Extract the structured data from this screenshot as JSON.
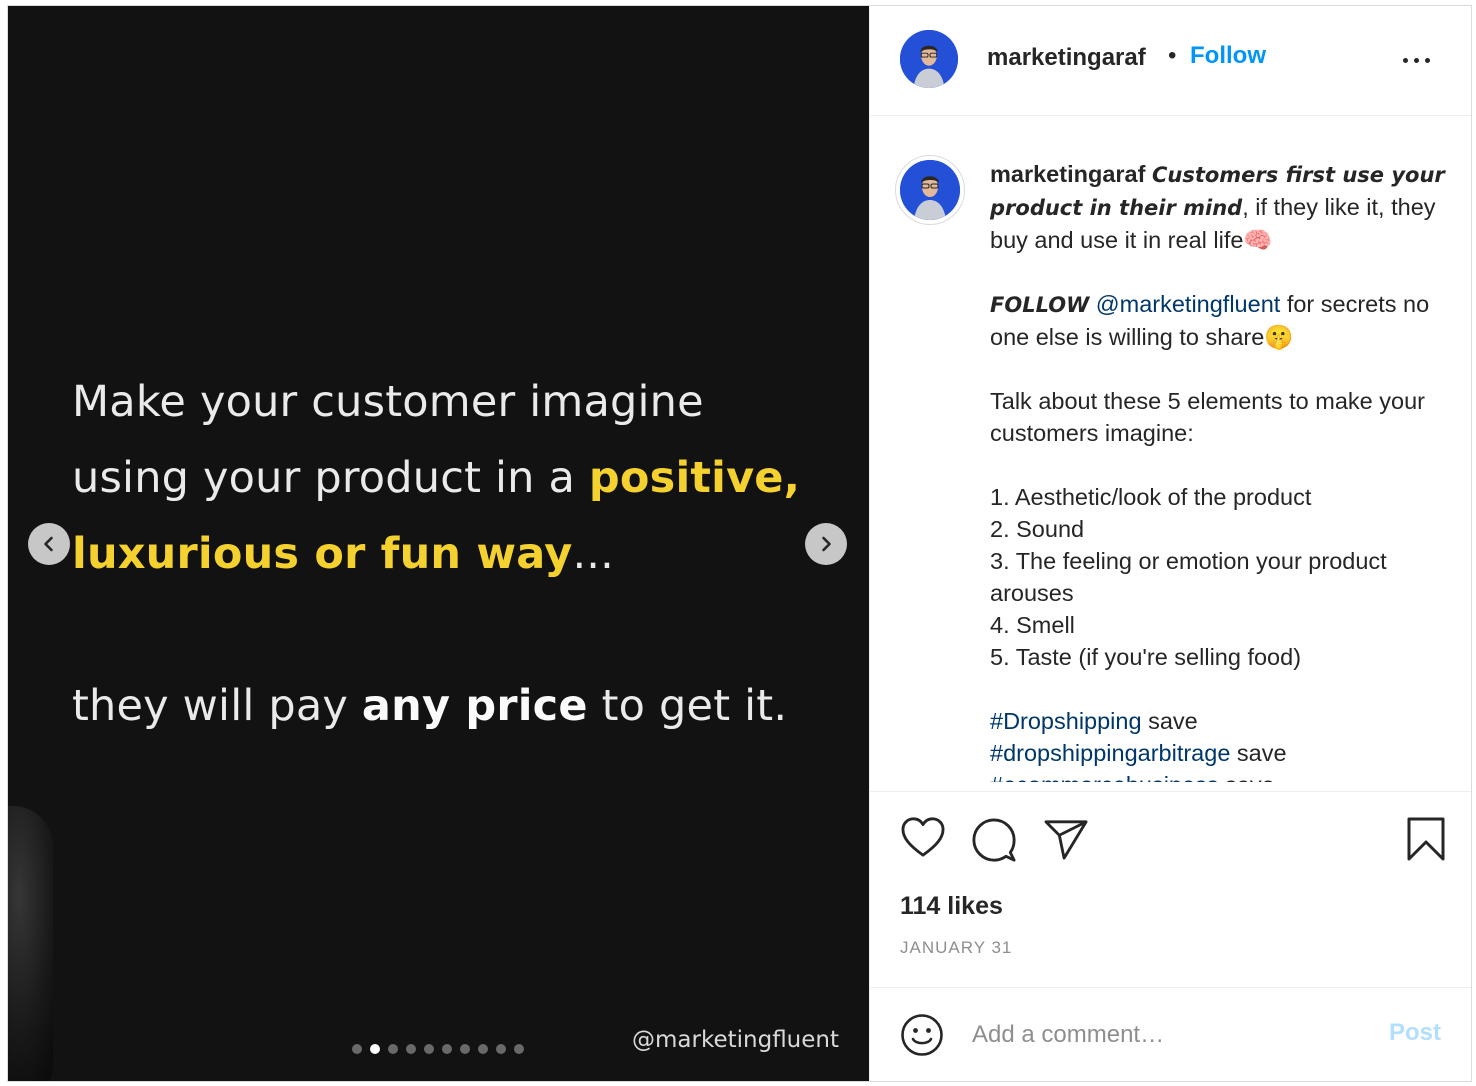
{
  "media": {
    "slide_lines": {
      "l1": "Make your customer imagine",
      "l2_plain": "using your product in a ",
      "l2_hl": "positive,",
      "l3_hl": "luxurious or fun way",
      "l3_plain": "...",
      "l4_a": "they will pay ",
      "l4_bold": "any price",
      "l4_b": " to get it."
    },
    "watermark": "@marketingfluent",
    "highlight_color": "#f5d12f",
    "carousel": {
      "total": 10,
      "active": 2
    }
  },
  "header": {
    "username": "marketingaraf",
    "separator": "•",
    "follow_label": "Follow"
  },
  "caption": {
    "username": "marketingaraf",
    "italic_lead": "Customers first use your product in their mind",
    "after_lead": ", if they like it, they buy and use it in real life🧠",
    "follow_word": "FOLLOW",
    "mention": "@marketingfluent",
    "follow_rest": " for secrets no one else is willing to share🤫",
    "intro": "Talk about these 5 elements to make your customers imagine:",
    "list": [
      "1. Aesthetic/look of the product",
      "2. Sound",
      "3. The feeling or emotion your product arouses",
      "4. Smell",
      "5. Taste (if you're selling food)"
    ],
    "hashtags": [
      {
        "tag": "#Dropshipping",
        "rest": " save"
      },
      {
        "tag": "#dropshippingarbitrage",
        "rest": " save"
      },
      {
        "tag": "#ecommercebusiness",
        "rest": " save"
      }
    ]
  },
  "footer": {
    "likes": "114 likes",
    "date": "JANUARY 31",
    "comment_placeholder": "Add a comment…",
    "post_label": "Post"
  },
  "icons": {
    "like": "heart-icon",
    "comment": "comment-icon",
    "share": "paper-plane-icon",
    "save": "bookmark-icon",
    "emoji": "smiley-icon",
    "more": "more-options-icon",
    "prev": "chevron-left-icon",
    "next": "chevron-right-icon"
  },
  "colors": {
    "follow": "#0095f6",
    "link": "#00376b",
    "post_disabled": "#b2dffc"
  }
}
